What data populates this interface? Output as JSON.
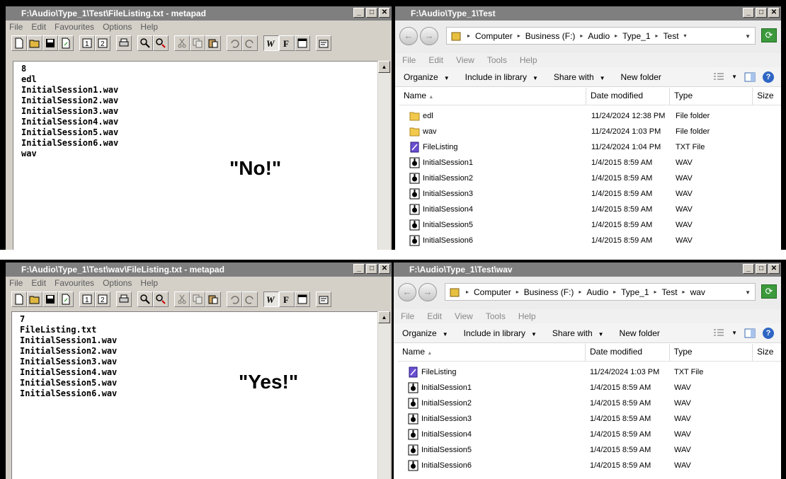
{
  "metapad_top": {
    "title": "F:\\Audio\\Type_1\\Test\\FileListing.txt - metapad",
    "menu": [
      "File",
      "Edit",
      "Favourites",
      "Options",
      "Help"
    ],
    "lines": [
      "8",
      "edl",
      "InitialSession1.wav",
      "InitialSession2.wav",
      "InitialSession3.wav",
      "InitialSession4.wav",
      "InitialSession5.wav",
      "InitialSession6.wav",
      "wav"
    ],
    "callout": "\"No!\""
  },
  "metapad_bottom": {
    "title": "F:\\Audio\\Type_1\\Test\\wav\\FileListing.txt - metapad",
    "menu": [
      "File",
      "Edit",
      "Favourites",
      "Options",
      "Help"
    ],
    "lines": [
      "7",
      "FileListing.txt",
      "InitialSession1.wav",
      "InitialSession2.wav",
      "InitialSession3.wav",
      "InitialSession4.wav",
      "InitialSession5.wav",
      "InitialSession6.wav"
    ],
    "callout": "\"Yes!\""
  },
  "explorer_top": {
    "title": "F:\\Audio\\Type_1\\Test",
    "breadcrumb": [
      "Computer",
      "Business (F:)",
      "Audio",
      "Type_1",
      "Test"
    ],
    "menu": [
      "File",
      "Edit",
      "View",
      "Tools",
      "Help"
    ],
    "commands": [
      "Organize",
      "Include in library",
      "Share with",
      "New folder"
    ],
    "columns": [
      "Name",
      "Date modified",
      "Type",
      "Size"
    ],
    "rows": [
      {
        "icon": "folder-icon",
        "name": "edl",
        "date": "11/24/2024 12:38 PM",
        "type": "File folder"
      },
      {
        "icon": "folder-icon",
        "name": "wav",
        "date": "11/24/2024 1:03 PM",
        "type": "File folder"
      },
      {
        "icon": "txt-file-icon",
        "name": "FileListing",
        "date": "11/24/2024 1:04 PM",
        "type": "TXT File"
      },
      {
        "icon": "wav-file-icon",
        "name": "InitialSession1",
        "date": "1/4/2015 8:59 AM",
        "type": "WAV"
      },
      {
        "icon": "wav-file-icon",
        "name": "InitialSession2",
        "date": "1/4/2015 8:59 AM",
        "type": "WAV"
      },
      {
        "icon": "wav-file-icon",
        "name": "InitialSession3",
        "date": "1/4/2015 8:59 AM",
        "type": "WAV"
      },
      {
        "icon": "wav-file-icon",
        "name": "InitialSession4",
        "date": "1/4/2015 8:59 AM",
        "type": "WAV"
      },
      {
        "icon": "wav-file-icon",
        "name": "InitialSession5",
        "date": "1/4/2015 8:59 AM",
        "type": "WAV"
      },
      {
        "icon": "wav-file-icon",
        "name": "InitialSession6",
        "date": "1/4/2015 8:59 AM",
        "type": "WAV"
      }
    ]
  },
  "explorer_bottom": {
    "title": "F:\\Audio\\Type_1\\Test\\wav",
    "breadcrumb": [
      "Computer",
      "Business (F:)",
      "Audio",
      "Type_1",
      "Test",
      "wav"
    ],
    "menu": [
      "File",
      "Edit",
      "View",
      "Tools",
      "Help"
    ],
    "commands": [
      "Organize",
      "Include in library",
      "Share with",
      "New folder"
    ],
    "columns": [
      "Name",
      "Date modified",
      "Type",
      "Size"
    ],
    "rows": [
      {
        "icon": "txt-file-icon",
        "name": "FileListing",
        "date": "11/24/2024 1:03 PM",
        "type": "TXT File"
      },
      {
        "icon": "wav-file-icon",
        "name": "InitialSession1",
        "date": "1/4/2015 8:59 AM",
        "type": "WAV"
      },
      {
        "icon": "wav-file-icon",
        "name": "InitialSession2",
        "date": "1/4/2015 8:59 AM",
        "type": "WAV"
      },
      {
        "icon": "wav-file-icon",
        "name": "InitialSession3",
        "date": "1/4/2015 8:59 AM",
        "type": "WAV"
      },
      {
        "icon": "wav-file-icon",
        "name": "InitialSession4",
        "date": "1/4/2015 8:59 AM",
        "type": "WAV"
      },
      {
        "icon": "wav-file-icon",
        "name": "InitialSession5",
        "date": "1/4/2015 8:59 AM",
        "type": "WAV"
      },
      {
        "icon": "wav-file-icon",
        "name": "InitialSession6",
        "date": "1/4/2015 8:59 AM",
        "type": "WAV"
      }
    ]
  },
  "colors": {
    "titlebar": "#7f7f7f",
    "window_face": "#d4d0c8",
    "refresh_green": "#3c9a3c"
  }
}
